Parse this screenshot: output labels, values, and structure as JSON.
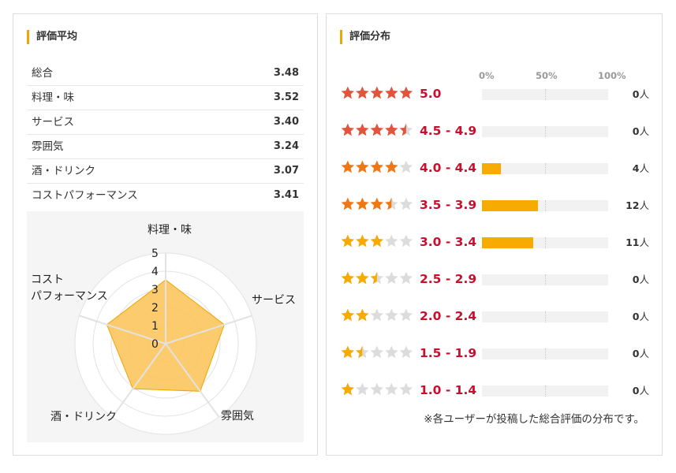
{
  "averages": {
    "title": "評価平均",
    "rows": [
      {
        "label": "総合",
        "value": "3.48"
      },
      {
        "label": "料理・味",
        "value": "3.52"
      },
      {
        "label": "サービス",
        "value": "3.40"
      },
      {
        "label": "雰囲気",
        "value": "3.24"
      },
      {
        "label": "酒・ドリンク",
        "value": "3.07"
      },
      {
        "label": "コストパフォーマンス",
        "value": "3.41"
      }
    ]
  },
  "radar": {
    "labels": {
      "taste": "料理・味",
      "service": "サービス",
      "atmosphere": "雰囲気",
      "drink": "酒・ドリンク",
      "cost_line1": "コスト",
      "cost_line2": "パフォーマンス"
    },
    "ticks": [
      "0",
      "1",
      "2",
      "3",
      "4",
      "5"
    ],
    "max": 5
  },
  "chart_data": {
    "type": "radar",
    "categories": [
      "料理・味",
      "サービス",
      "雰囲気",
      "酒・ドリンク",
      "コストパフォーマンス"
    ],
    "values": [
      3.52,
      3.4,
      3.24,
      3.07,
      3.41
    ],
    "range": [
      0,
      5
    ]
  },
  "distribution": {
    "title": "評価分布",
    "axis": {
      "p0": "0%",
      "p50": "50%",
      "p100": "100%"
    },
    "unit": "人",
    "rows": [
      {
        "stars": 5.0,
        "range": "5.0",
        "count": 0,
        "count_text": "0",
        "color": "#e2543c"
      },
      {
        "stars": 4.5,
        "range": "4.5 - 4.9",
        "count": 0,
        "count_text": "0",
        "color": "#e2543c"
      },
      {
        "stars": 4.0,
        "range": "4.0 - 4.4",
        "count": 4,
        "count_text": "4",
        "color": "#f07814"
      },
      {
        "stars": 3.5,
        "range": "3.5 - 3.9",
        "count": 12,
        "count_text": "12",
        "color": "#f07814"
      },
      {
        "stars": 3.0,
        "range": "3.0 - 3.4",
        "count": 11,
        "count_text": "11",
        "color": "#f7ab00"
      },
      {
        "stars": 2.5,
        "range": "2.5 - 2.9",
        "count": 0,
        "count_text": "0",
        "color": "#f7ab00"
      },
      {
        "stars": 2.0,
        "range": "2.0 - 2.4",
        "count": 0,
        "count_text": "0",
        "color": "#f7ab00"
      },
      {
        "stars": 1.5,
        "range": "1.5 - 1.9",
        "count": 0,
        "count_text": "0",
        "color": "#f7ab00"
      },
      {
        "stars": 1.0,
        "range": "1.0 - 1.4",
        "count": 0,
        "count_text": "0",
        "color": "#f7ab00"
      }
    ],
    "note": "※各ユーザーが投稿した総合評価の分布です。"
  },
  "colors": {
    "accent": "#f0a500",
    "range_text": "#c8102e",
    "bar_fill": "#f7ab00",
    "radar_fill": "#fbc45a",
    "star_empty": "#dcdcdc"
  }
}
